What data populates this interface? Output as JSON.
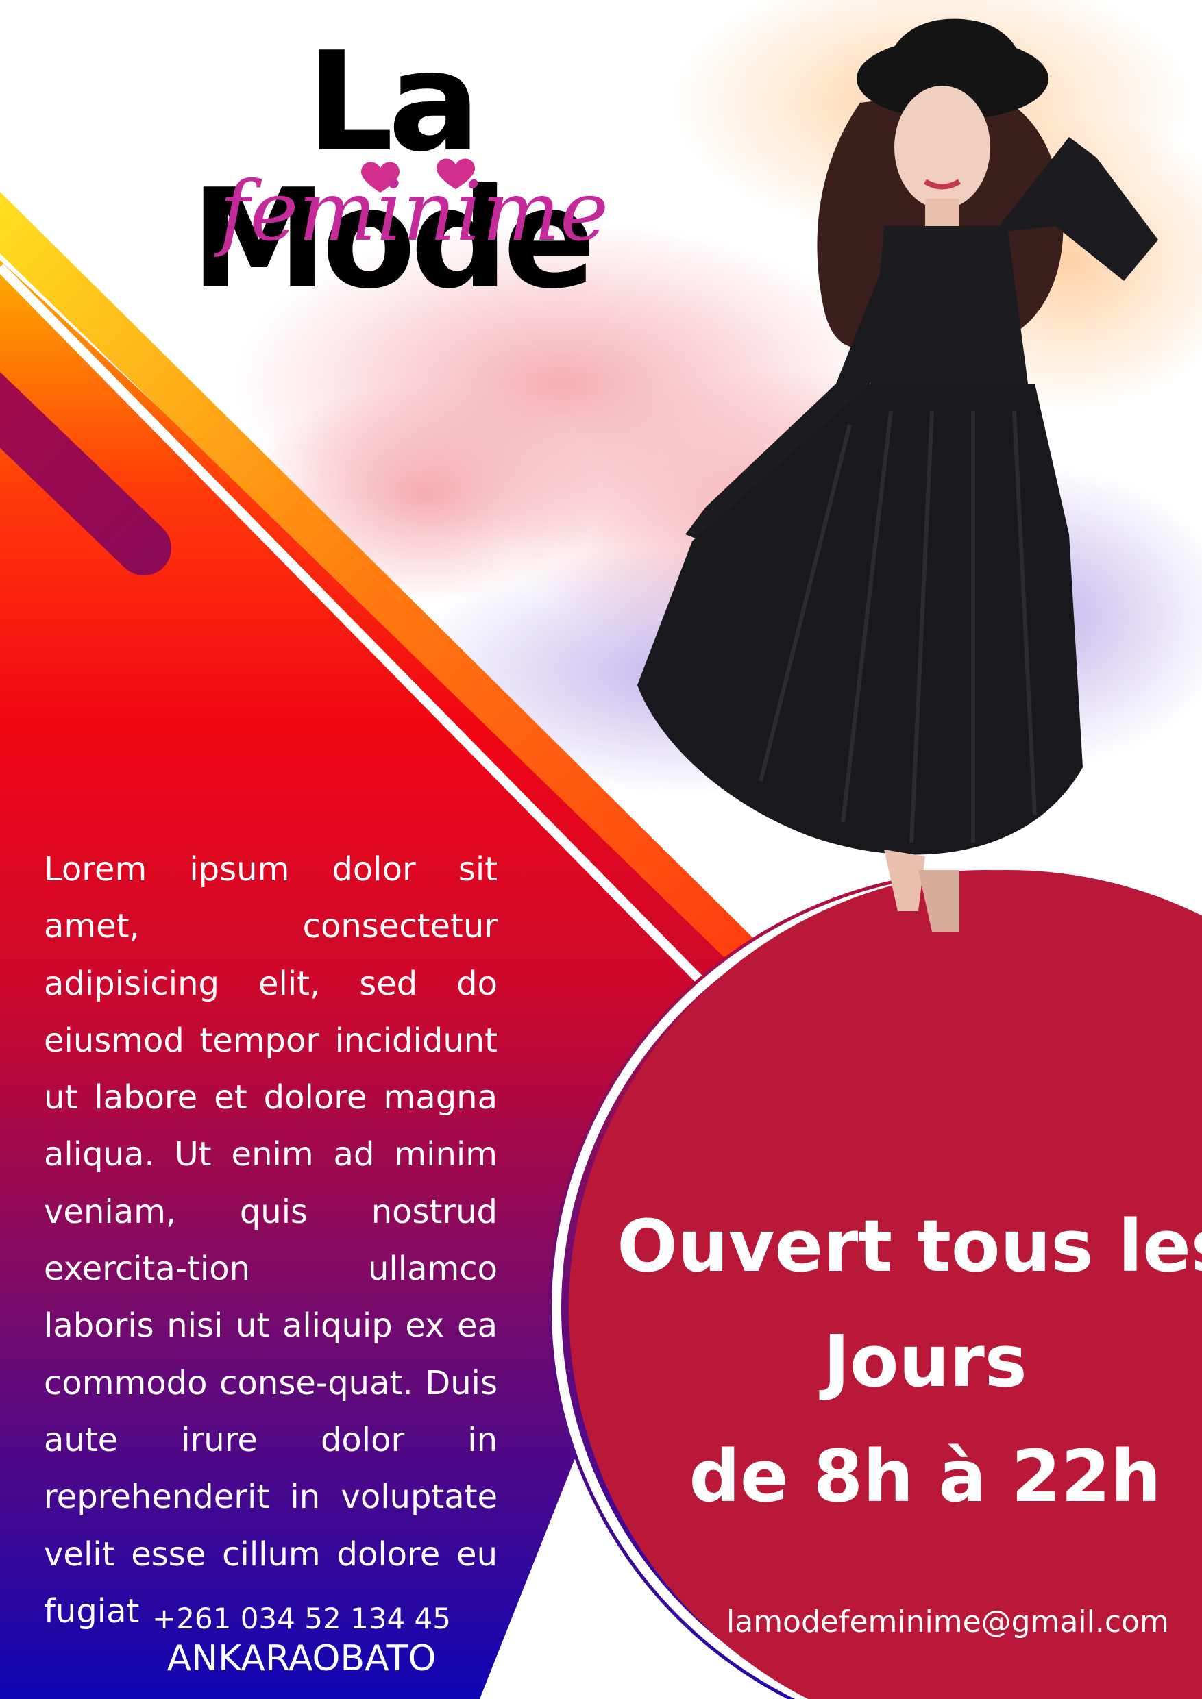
{
  "brand": {
    "title": "La Mode",
    "subtitle": "feminime"
  },
  "content": {
    "body": "Lorem ipsum dolor sit amet, consectetur adipisicing elit, sed do eiusmod tempor incididunt ut labore et dolore magna aliqua. Ut enim ad minim veniam, quis nostrud exercita-tion ullamco laboris nisi ut aliquip ex ea commodo conse-quat. Duis aute irure dolor in reprehenderit in voluptate velit esse cillum dolore eu fugiat"
  },
  "hours": {
    "line1": "Ouvert tous les",
    "line2": "Jours",
    "line3": "de 8h à 22h"
  },
  "contact": {
    "phone": "+261 034 52 134 45",
    "city": "ANKARAOBATO",
    "email": "lamodefeminime@gmail.com"
  },
  "colors": {
    "accent": "#ba1838",
    "gradient_top": "#f20613",
    "gradient_bottom": "#0f06b4",
    "logo_pink": "#c52a9a"
  }
}
